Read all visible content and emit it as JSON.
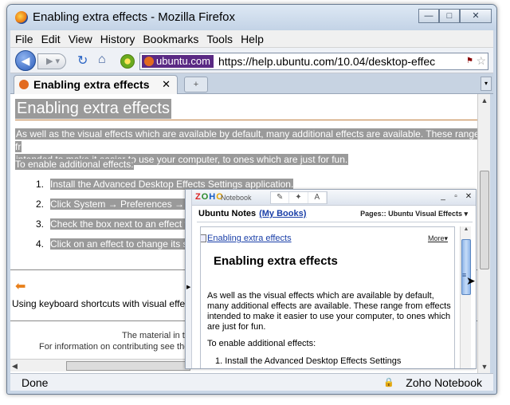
{
  "window": {
    "title": "Enabling extra effects - Mozilla Firefox",
    "controls": {
      "minimize": "—",
      "maximize": "□",
      "close": "✕"
    }
  },
  "menu": [
    "File",
    "Edit",
    "View",
    "History",
    "Bookmarks",
    "Tools",
    "Help"
  ],
  "nav": {
    "site_identity": "ubuntu.com",
    "url": "https://help.ubuntu.com/10.04/desktop-effec",
    "back_icon": "back-arrow-icon",
    "forward_icon": "forward-arrow-icon",
    "reload_icon": "reload-icon",
    "home_icon": "home-icon"
  },
  "tab": {
    "label": "Enabling extra effects",
    "close": "✕",
    "new_tab": "+"
  },
  "page": {
    "heading": "Enabling extra effects",
    "intro_line1": "As well as the visual effects which are available by default, many additional effects are available. These range fr",
    "intro_line2": "intended to make it easier to use your computer, to ones which are just for fun.",
    "to_enable": "To enable additional effects:",
    "steps": [
      {
        "num": "1.",
        "text": "Install the Advanced Desktop Effects Settings application."
      },
      {
        "num": "2.",
        "text": "Click System → Preferences → Co"
      },
      {
        "num": "3.",
        "text": "Check the box next to an effect to"
      },
      {
        "num": "4.",
        "text": "Click on an effect to change its se"
      }
    ],
    "prev_link": "Using keyboard shortcuts with visual effect",
    "footer_line1": "The material in th",
    "footer_line2_prefix": "For information on contributing see the ",
    "footer_line2_link": "U"
  },
  "status": {
    "left": "Done",
    "right": "Zoho Notebook"
  },
  "zoho": {
    "logo": [
      "Z",
      "O",
      "H",
      "O"
    ],
    "notebook_label": "Notebook",
    "window_buttons": [
      "_",
      "▫",
      "✕"
    ],
    "notes_title": "Ubuntu Notes",
    "my_books": "(My Books)",
    "pages_label": "Pages:: Ubuntu Visual Effects",
    "page_link": "Enabling extra effects",
    "more": "More",
    "heading": "Enabling extra effects",
    "para1": "As well as the visual effects which are available by default, many additional effects are available. These range from effects intended to make it easier to use your computer, to ones which are just for fun.",
    "para2": "To enable additional effects:",
    "list_item": "1.  Install the Advanced Desktop Effects Settings"
  }
}
